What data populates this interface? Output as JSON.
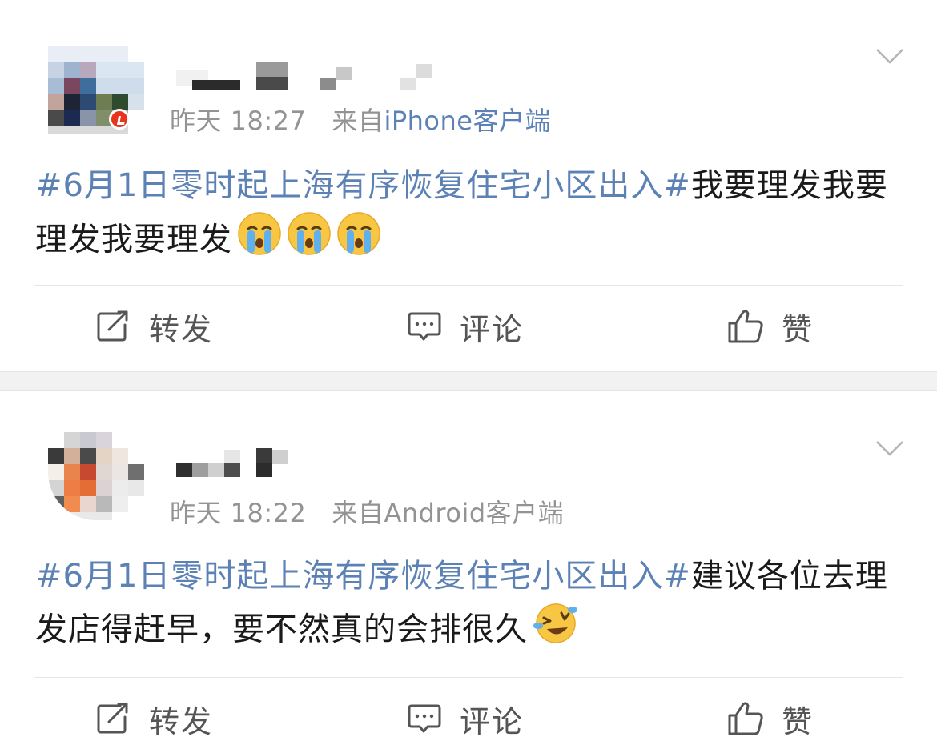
{
  "posts": [
    {
      "time": "昨天 18:27",
      "source_prefix": "来自",
      "source": "iPhone客户端",
      "hashtag": "#6月1日零时起上海有序恢复住宅小区出入#",
      "text": "我要理发我要理发我要理发",
      "emojis": [
        "crying-emoji",
        "crying-emoji",
        "crying-emoji"
      ],
      "actions": {
        "repost": "转发",
        "comment": "评论",
        "like": "赞"
      }
    },
    {
      "time": "昨天 18:22",
      "source_prefix": "来自",
      "source": "Android客户端",
      "hashtag": "#6月1日零时起上海有序恢复住宅小区出入#",
      "text": "建议各位去理发店得赶早，要不然真的会排很久",
      "emojis": [
        "laughing-tears-emoji"
      ],
      "actions": {
        "repost": "转发",
        "comment": "评论",
        "like": "赞"
      }
    }
  ],
  "colors": {
    "link": "#5b81b5",
    "meta": "#939393",
    "body_text": "#1a1a1a",
    "separator": "#f2f2f2"
  }
}
